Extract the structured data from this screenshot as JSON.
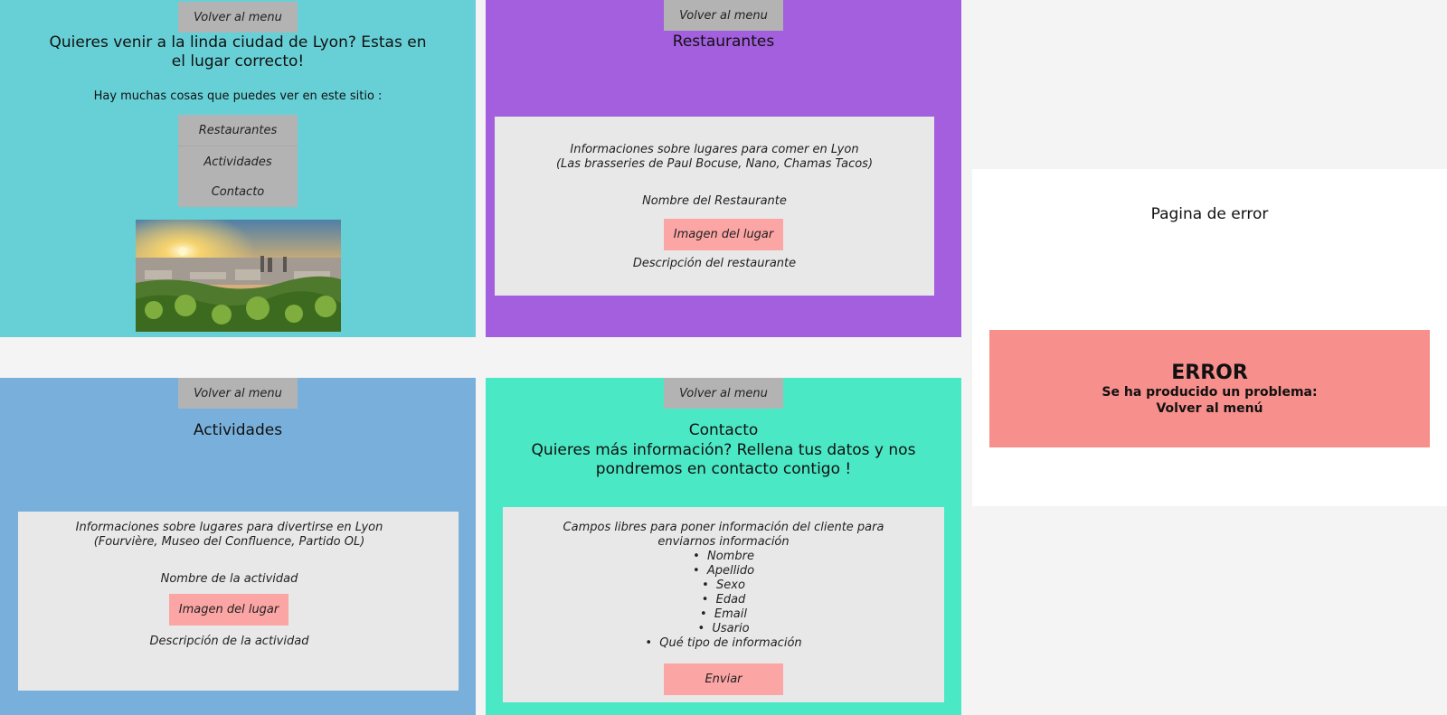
{
  "colors": {
    "home_bg": "#67d0d6",
    "restaurants_bg": "#a35fde",
    "activities_bg": "#79b0db",
    "contact_bg": "#4be8c5",
    "button_gray": "#b3b3b3",
    "panel_gray": "#e8e8e8",
    "image_placeholder": "#fca5a5",
    "error_bar": "#f78f8c",
    "page_bg": "#f4f4f4"
  },
  "home": {
    "back_button": "Volver al menu",
    "title": "Quieres venir a la linda ciudad de Lyon? Estas en el lugar correcto!",
    "subtitle": "Hay muchas cosas que puedes ver en este sitio :",
    "menu": [
      "Restaurantes",
      "Actividades",
      "Contacto"
    ],
    "image_icon": "lyon-sunset-photo"
  },
  "restaurants": {
    "back_button": "Volver al menu",
    "title": "Restaurantes",
    "info_line1": "Informaciones sobre lugares para comer en Lyon",
    "info_line2": "(Las brasseries de Paul Bocuse, Nano, Chamas Tacos)",
    "name_label": "Nombre del Restaurante",
    "image_label": "Imagen del lugar",
    "description_label": "Descripción del restaurante"
  },
  "activities": {
    "back_button": "Volver al menu",
    "title": "Actividades",
    "info_line1": "Informaciones sobre lugares para divertirse en Lyon",
    "info_line2": "(Fourvière, Museo del Confluence, Partido OL)",
    "name_label": "Nombre de la actividad",
    "image_label": "Imagen del lugar",
    "description_label": "Descripción de la actividad"
  },
  "contact": {
    "back_button": "Volver al menu",
    "title_line1": "Contacto",
    "title_line2": "Quieres más información? Rellena tus datos y nos pondremos en contacto contigo !",
    "info": "Campos libres para poner información del cliente para enviarnos información",
    "fields": [
      "Nombre",
      "Apellido",
      "Sexo",
      "Edad",
      "Email",
      "Usario",
      "Qué tipo de información"
    ],
    "submit_button": "Enviar"
  },
  "error_page": {
    "title": "Pagina de error",
    "heading": "ERROR",
    "message": "Se ha producido un problema: Volver al menú"
  }
}
